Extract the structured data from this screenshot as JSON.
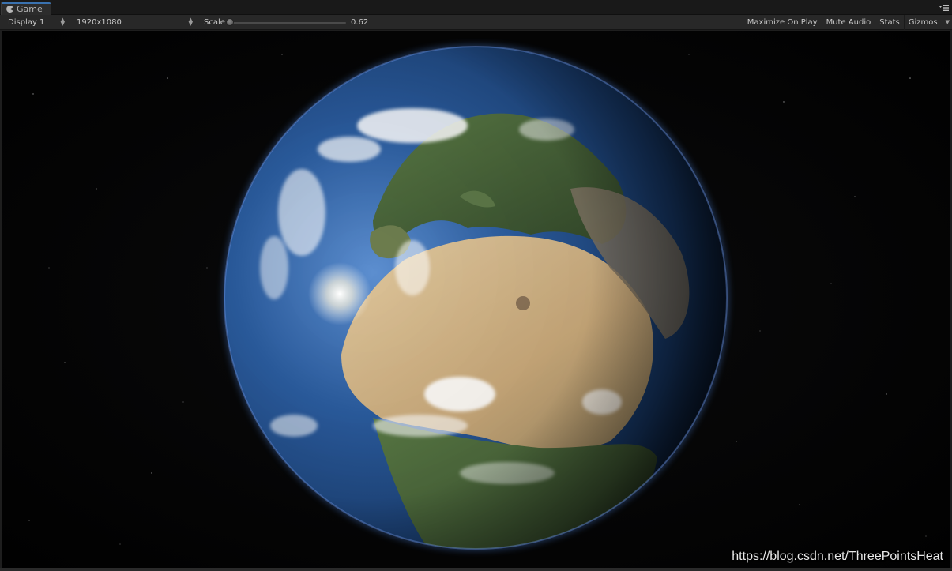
{
  "tab": {
    "label": "Game",
    "icon": "pacman-icon"
  },
  "toolbar": {
    "display": "Display 1",
    "resolution": "1920x1080",
    "scale_label": "Scale",
    "scale_value": "0.62",
    "maximize": "Maximize On Play",
    "mute": "Mute Audio",
    "stats": "Stats",
    "gizmos": "Gizmos"
  },
  "viewport": {
    "watermark": "https://blog.csdn.net/ThreePointsHeat"
  },
  "colors": {
    "accent": "#3a72b0",
    "ocean": "#2b5c9e",
    "land": "#c9b48a",
    "space": "#000000"
  }
}
